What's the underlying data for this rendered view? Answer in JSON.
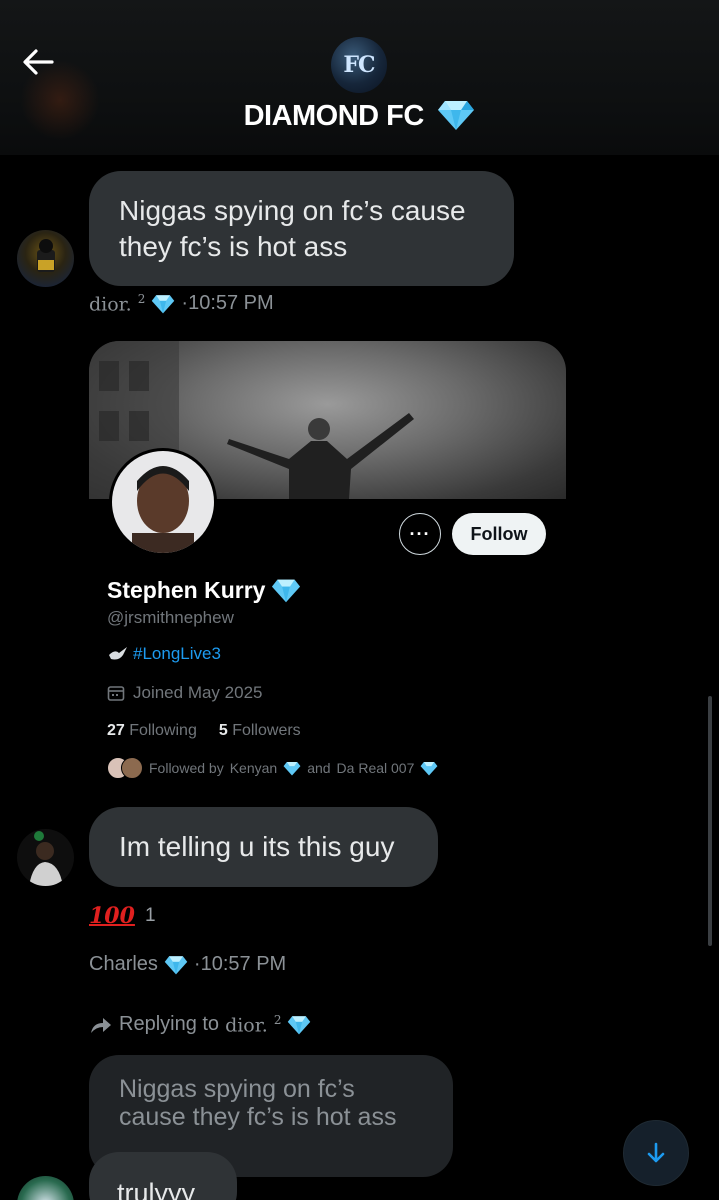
{
  "header": {
    "group_avatar_text": "FC",
    "title": "DIAMOND FC",
    "title_icon": "diamond-icon",
    "back_icon": "arrow-left-icon"
  },
  "messages": [
    {
      "text": "Niggas spying on fc’s cause they fc’s is hot ass",
      "author": "dior.",
      "author_sup": "2",
      "time": "·10:57 PM"
    },
    {
      "text": "Im telling u its this guy",
      "reaction_emoji": "100",
      "reaction_count": "1",
      "author": "Charles",
      "time": "·10:57 PM"
    }
  ],
  "profile_card": {
    "name": "Stephen Kurry",
    "handle": "@jrsmithnephew",
    "bio": "#LongLive3",
    "joined": "Joined May 2025",
    "following_count": "27",
    "following_label": "Following",
    "followers_count": "5",
    "followers_label": "Followers",
    "followed_by_prefix": "Followed by",
    "followed_by_1": "Kenyan",
    "followed_by_and": "and",
    "followed_by_2": "Da Real 007",
    "follow_label": "Follow",
    "more_label": "···"
  },
  "reply": {
    "prefix": "Replying to",
    "name": "dior.",
    "name_sup": "2",
    "quoted_text": "Niggas spying on fc’s cause they fc’s is hot ass",
    "text": "trulyyy"
  },
  "colors": {
    "background": "#000000",
    "bubble": "#2f3336",
    "accent_blue": "#1d9bf0",
    "diamond": "#5ec8f5"
  }
}
